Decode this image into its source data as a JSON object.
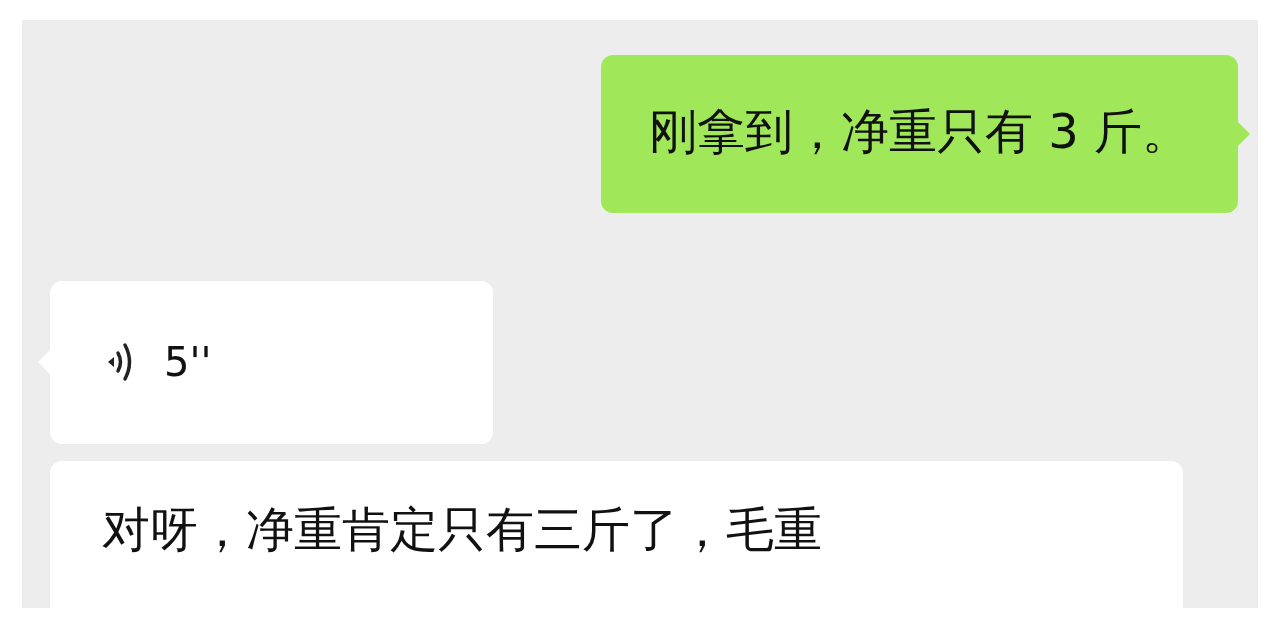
{
  "messages": [
    {
      "sent": true,
      "kind": "text",
      "tail": true,
      "text": "刚拿到，净重只有 3 斤。"
    },
    {
      "sent": false,
      "kind": "voice",
      "tail": true,
      "duration": "5''"
    },
    {
      "sent": false,
      "kind": "text",
      "tail": false,
      "text": "对呀，净重肯定只有三斤了，毛重"
    }
  ]
}
